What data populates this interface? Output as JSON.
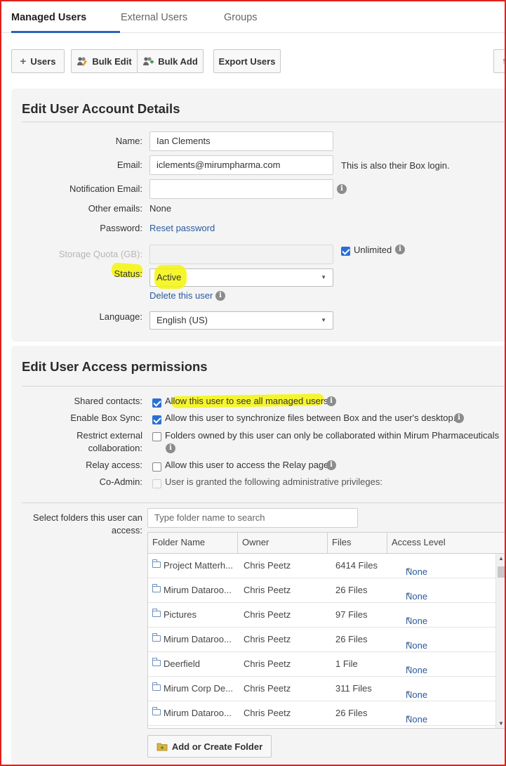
{
  "tabs": [
    {
      "label": "Managed Users"
    },
    {
      "label": "External Users"
    },
    {
      "label": "Groups"
    }
  ],
  "toolbar": {
    "users": "Users",
    "bulk_edit": "Bulk Edit",
    "bulk_add": "Bulk Add",
    "export": "Export Users"
  },
  "account": {
    "title": "Edit User Account Details",
    "name_label": "Name:",
    "name_value": "Ian Clements",
    "email_label": "Email:",
    "email_value": "iclements@mirumpharma.com",
    "email_hint": "This is also their Box login.",
    "notif_label": "Notification Email:",
    "notif_value": "",
    "other_label": "Other emails:",
    "other_value": "None",
    "password_label": "Password:",
    "password_link": "Reset password",
    "quota_label": "Storage Quota (GB):",
    "quota_value": "",
    "unlimited_label": "Unlimited",
    "status_label": "Status:",
    "status_value": "Active",
    "delete_link": "Delete this user",
    "language_label": "Language:",
    "language_value": "English (US)"
  },
  "access": {
    "title": "Edit User Access permissions",
    "rows": [
      {
        "label": "Shared contacts:",
        "text": "Allow this user to see all managed users",
        "checked": true
      },
      {
        "label": "Enable Box Sync:",
        "text": "Allow this user to synchronize files between Box and the user's desktop.",
        "checked": true
      },
      {
        "label1": "Restrict external",
        "label2": "collaboration:",
        "text": "Folders owned by this user can only be collaborated within Mirum Pharmaceuticals",
        "checked": false
      },
      {
        "label": "Relay access:",
        "text": "Allow this user to access the Relay page",
        "checked": false
      },
      {
        "label": "Co-Admin:",
        "text": "User is granted the following administrative privileges:",
        "checked": false
      }
    ],
    "folders_label1": "Select folders this user can",
    "folders_label2": "access:",
    "search_placeholder": "Type folder name to search",
    "columns": [
      "Folder Name",
      "Owner",
      "Files",
      "Access Level"
    ],
    "folders": [
      {
        "name": "Project Matterh...",
        "owner": "Chris Peetz",
        "files": "6414 Files",
        "access": "None"
      },
      {
        "name": "Mirum Dataroo...",
        "owner": "Chris Peetz",
        "files": "26 Files",
        "access": "None"
      },
      {
        "name": "Pictures",
        "owner": "Chris Peetz",
        "files": "97 Files",
        "access": "None"
      },
      {
        "name": "Mirum Dataroo...",
        "owner": "Chris Peetz",
        "files": "26 Files",
        "access": "None"
      },
      {
        "name": "Deerfield",
        "owner": "Chris Peetz",
        "files": "1 File",
        "access": "None"
      },
      {
        "name": "Mirum Corp De...",
        "owner": "Chris Peetz",
        "files": "311 Files",
        "access": "None"
      },
      {
        "name": "Mirum Dataroo...",
        "owner": "Chris Peetz",
        "files": "26 Files",
        "access": "None"
      }
    ],
    "add_folder": "Add or Create Folder"
  },
  "colors": {
    "accent": "#2a62bc",
    "highlight": "#f5f50a",
    "frame": "#e0201c",
    "link": "#2a5a9d"
  }
}
